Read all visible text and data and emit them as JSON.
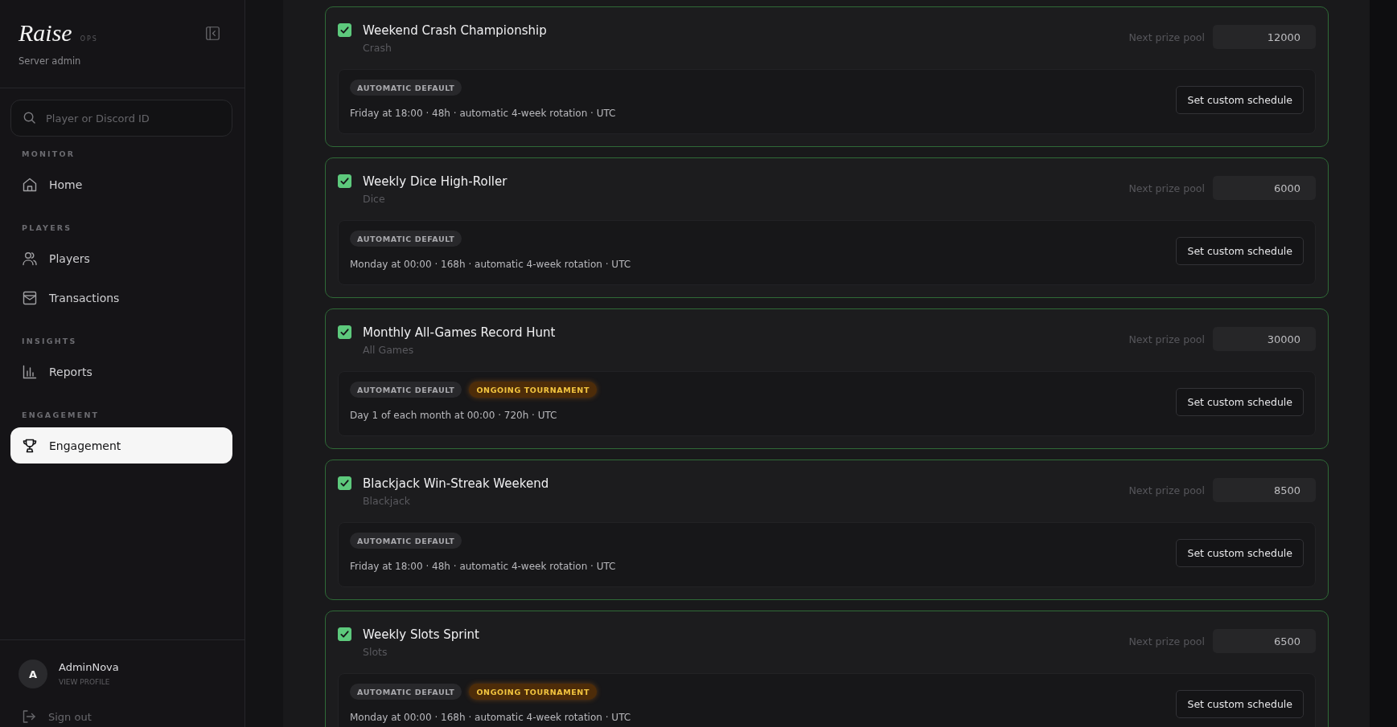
{
  "sidebar": {
    "brand": {
      "name": "Raise",
      "tag": "OPS",
      "subtitle": "Server admin"
    },
    "search": {
      "placeholder": "Player or Discord ID"
    },
    "sections": [
      {
        "heading": "MONITOR",
        "items": [
          {
            "label": "Home",
            "selected": false
          }
        ]
      },
      {
        "heading": "PLAYERS",
        "items": [
          {
            "label": "Players",
            "selected": false
          },
          {
            "label": "Transactions",
            "selected": false
          }
        ]
      },
      {
        "heading": "INSIGHTS",
        "items": [
          {
            "label": "Reports",
            "selected": false
          }
        ]
      },
      {
        "heading": "ENGAGEMENT",
        "items": [
          {
            "label": "Engagement",
            "selected": true
          }
        ]
      }
    ],
    "user": {
      "initial": "A",
      "name": "AdminNova",
      "link": "VIEW PROFILE"
    },
    "sign_out": "Sign out"
  },
  "tournaments": [
    {
      "checked": true,
      "name": "Weekend Crash Championship",
      "game": "Crash",
      "prize_label": "Next prize pool",
      "prize_pool": "12000",
      "badges": [
        {
          "label": "AUTOMATIC DEFAULT",
          "kind": "default"
        }
      ],
      "schedule": "Friday at 18:00 · 48h · automatic 4-week rotation · UTC",
      "action": "Set custom schedule"
    },
    {
      "checked": true,
      "name": "Weekly Dice High-Roller",
      "game": "Dice",
      "prize_label": "Next prize pool",
      "prize_pool": "6000",
      "badges": [
        {
          "label": "AUTOMATIC DEFAULT",
          "kind": "default"
        }
      ],
      "schedule": "Monday at 00:00 · 168h · automatic 4-week rotation · UTC",
      "action": "Set custom schedule"
    },
    {
      "checked": true,
      "name": "Monthly All-Games Record Hunt",
      "game": "All Games",
      "prize_label": "Next prize pool",
      "prize_pool": "30000",
      "badges": [
        {
          "label": "AUTOMATIC DEFAULT",
          "kind": "default"
        },
        {
          "label": "ONGOING TOURNAMENT",
          "kind": "ongoing"
        }
      ],
      "schedule": "Day 1 of each month at 00:00 · 720h · UTC",
      "action": "Set custom schedule"
    },
    {
      "checked": true,
      "name": "Blackjack Win-Streak Weekend",
      "game": "Blackjack",
      "prize_label": "Next prize pool",
      "prize_pool": "8500",
      "badges": [
        {
          "label": "AUTOMATIC DEFAULT",
          "kind": "default"
        }
      ],
      "schedule": "Friday at 18:00 · 48h · automatic 4-week rotation · UTC",
      "action": "Set custom schedule"
    },
    {
      "checked": true,
      "name": "Weekly Slots Sprint",
      "game": "Slots",
      "prize_label": "Next prize pool",
      "prize_pool": "6500",
      "badges": [
        {
          "label": "AUTOMATIC DEFAULT",
          "kind": "default"
        },
        {
          "label": "ONGOING TOURNAMENT",
          "kind": "ongoing"
        }
      ],
      "schedule": "Monday at 00:00 · 168h · automatic 4-week rotation · UTC",
      "action": "Set custom schedule"
    }
  ]
}
